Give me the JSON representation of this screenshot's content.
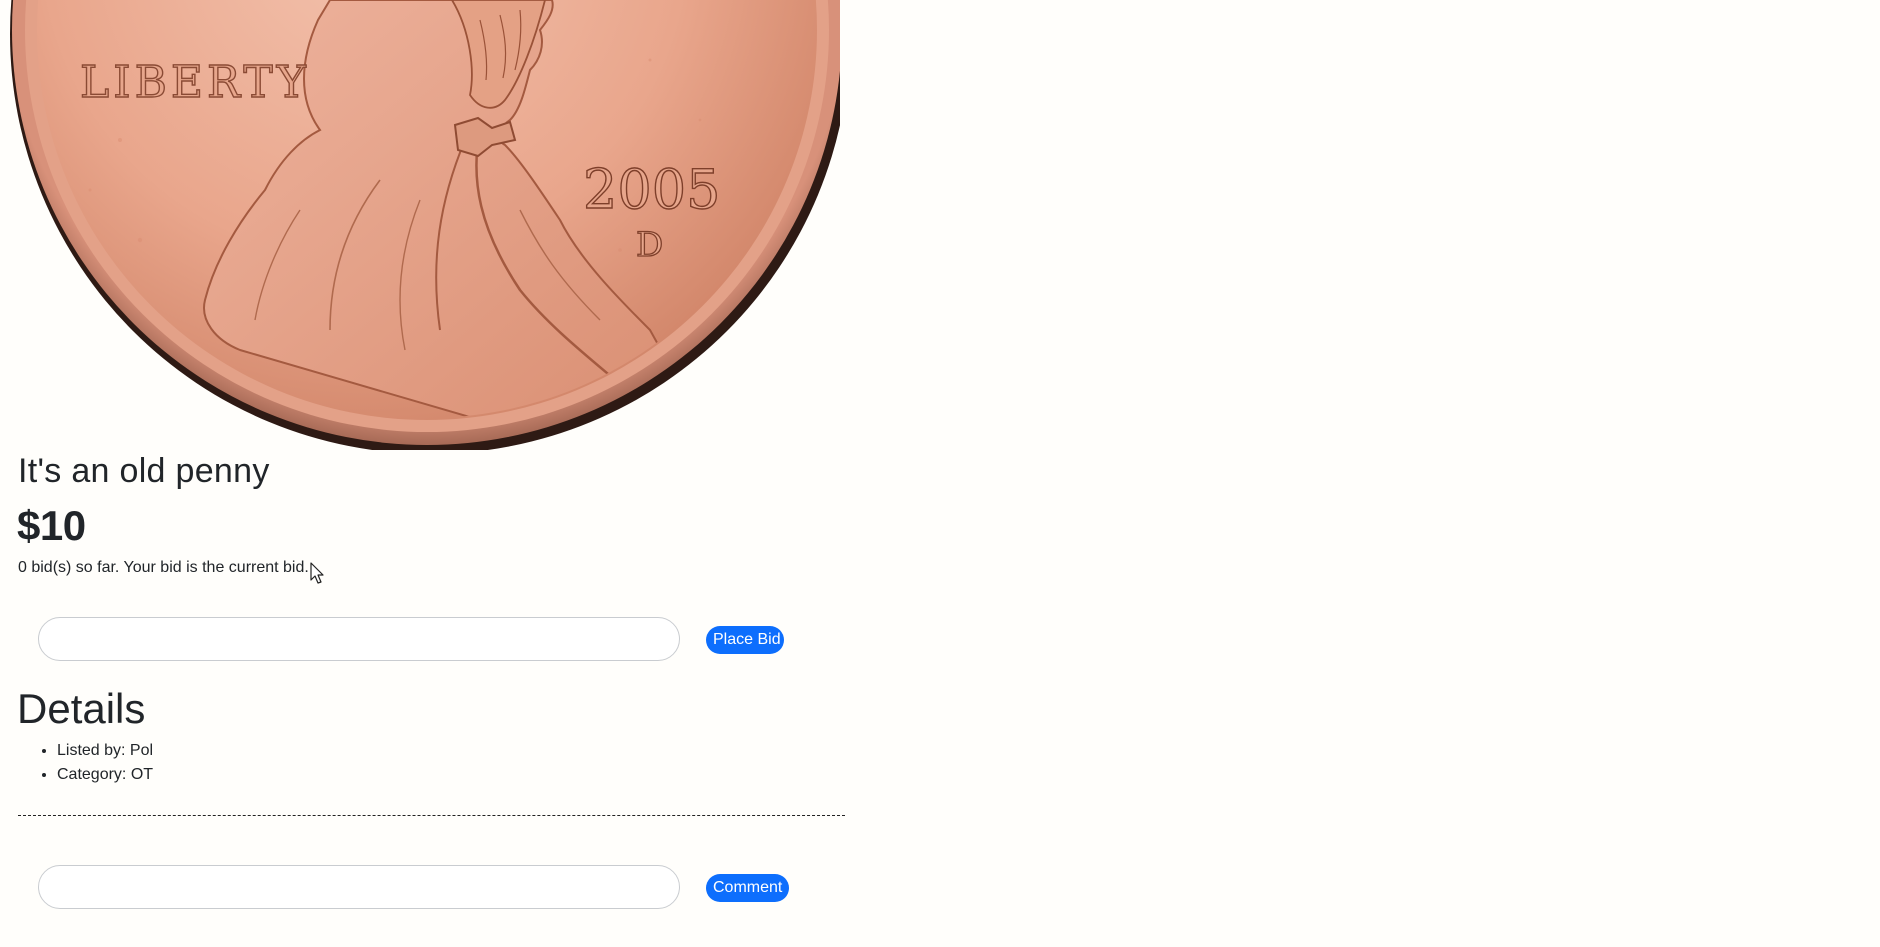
{
  "listing": {
    "image_alt": "Lincoln penny",
    "coin_inscription": "LIBERTY",
    "coin_year": "2005",
    "coin_mint_mark": "D",
    "title": "It's an old penny",
    "price": "$10",
    "bid_status": "0 bid(s) so far. Your bid is the current bid."
  },
  "bid_form": {
    "input_value": "",
    "input_placeholder": "",
    "button_label": "Place Bid"
  },
  "details": {
    "heading": "Details",
    "items": [
      "Listed by: Pol",
      "Category: OT"
    ]
  },
  "comment_form": {
    "input_value": "",
    "input_placeholder": "",
    "button_label": "Comment"
  },
  "colors": {
    "page_background": "#fffefb",
    "accent": "#0d6efd",
    "text": "#212529",
    "coin_copper": "#e8a48a"
  },
  "icons": {
    "cursor": "mouse-pointer-icon"
  }
}
